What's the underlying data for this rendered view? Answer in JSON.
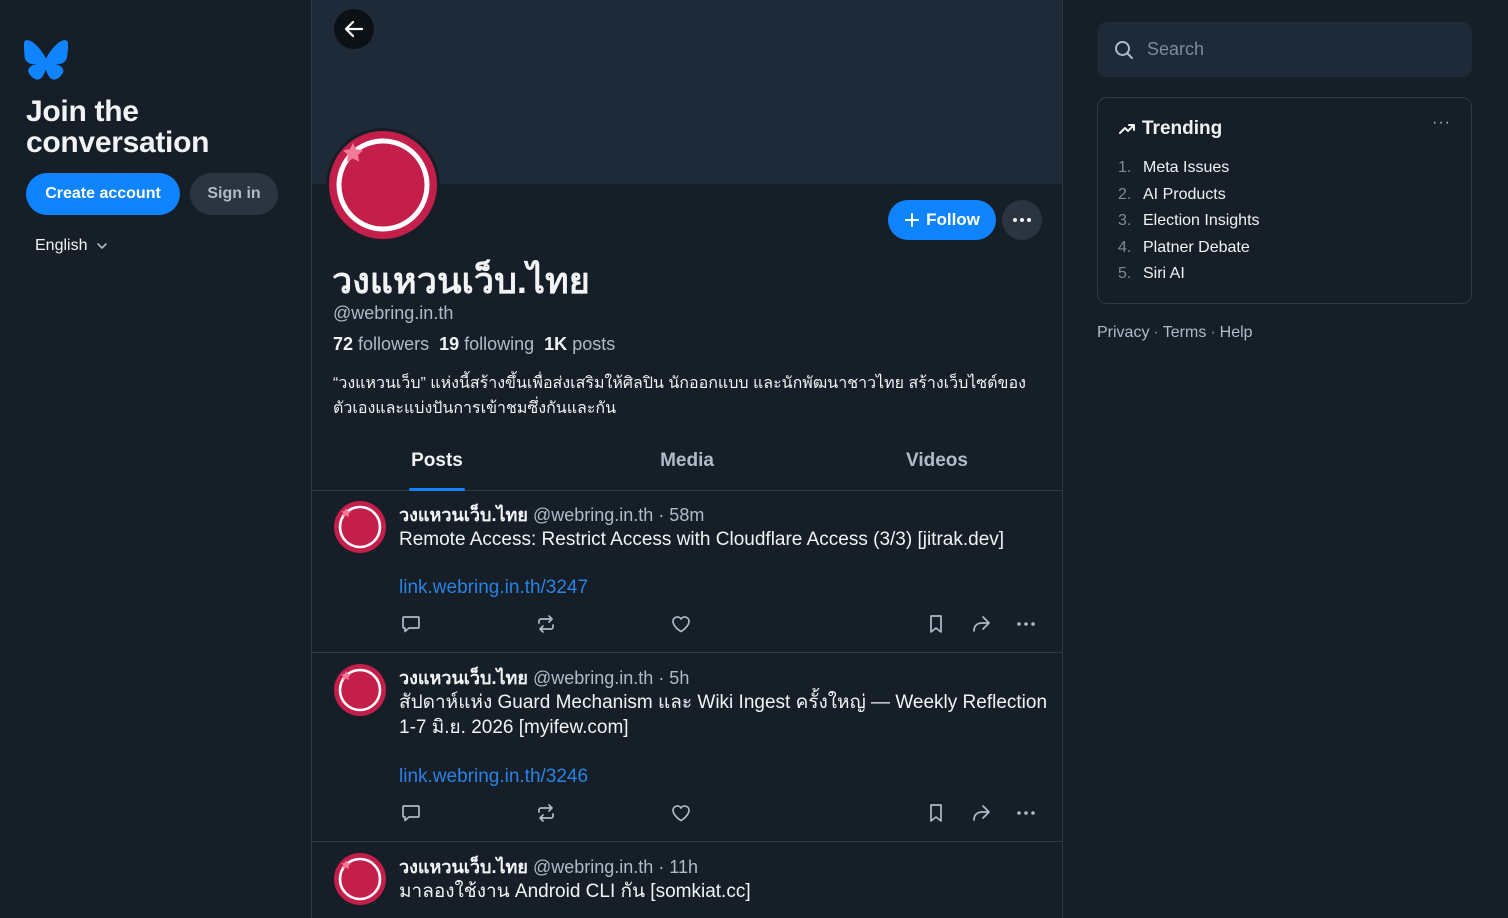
{
  "colors": {
    "background": "#161e27",
    "accent": "#1083fe",
    "link": "#2a82e4",
    "avatar": "#c41e4b",
    "muted_text": "#aebbc9"
  },
  "sidebar": {
    "logo_icon": "butterfly-icon",
    "title": "Join the conversation",
    "create_account_label": "Create account",
    "sign_in_label": "Sign in",
    "language": "English"
  },
  "profile": {
    "display_name": "วงแหวนเว็บ.ไทย",
    "handle": "@webring.in.th",
    "followers_count": "72",
    "followers_label": "followers",
    "following_count": "19",
    "following_label": "following",
    "posts_count": "1K",
    "posts_label": "posts",
    "bio": "“วงแหวนเว็บ” แห่งนี้สร้างขึ้นเพื่อส่งเสริมให้ศิลปิน นักออกแบบ และนักพัฒนาชาวไทย สร้างเว็บไซต์ของตัวเองและแบ่งปันการเข้าชมซึ่งกันและกัน",
    "follow_label": "Follow"
  },
  "tabs": [
    {
      "label": "Posts",
      "active": true
    },
    {
      "label": "Media",
      "active": false
    },
    {
      "label": "Videos",
      "active": false
    }
  ],
  "posts": [
    {
      "author": "วงแหวนเว็บ.ไทย",
      "handle": "@webring.in.th",
      "time": "· 58m",
      "text": "Remote Access: Restrict Access with Cloudflare Access (3/3) [jitrak.dev]",
      "link": "link.webring.in.th/3247"
    },
    {
      "author": "วงแหวนเว็บ.ไทย",
      "handle": "@webring.in.th",
      "time": "· 5h",
      "text": "สัปดาห์แห่ง Guard Mechanism และ Wiki Ingest ครั้งใหญ่ — Weekly Reflection 1-7 มิ.ย. 2026 [myifew.com]",
      "link": "link.webring.in.th/3246"
    },
    {
      "author": "วงแหวนเว็บ.ไทย",
      "handle": "@webring.in.th",
      "time": "· 11h",
      "text": "มาลองใช้งาน Android CLI กัน [somkiat.cc]",
      "link": ""
    }
  ],
  "search": {
    "placeholder": "Search"
  },
  "trending": {
    "title": "Trending",
    "more": "···",
    "items": [
      {
        "num": "1.",
        "label": "Meta Issues"
      },
      {
        "num": "2.",
        "label": "AI Products"
      },
      {
        "num": "3.",
        "label": "Election Insights"
      },
      {
        "num": "4.",
        "label": "Platner Debate"
      },
      {
        "num": "5.",
        "label": "Siri AI"
      }
    ]
  },
  "footer": {
    "privacy": "Privacy",
    "terms": "Terms",
    "help": "Help",
    "separator": "·"
  }
}
